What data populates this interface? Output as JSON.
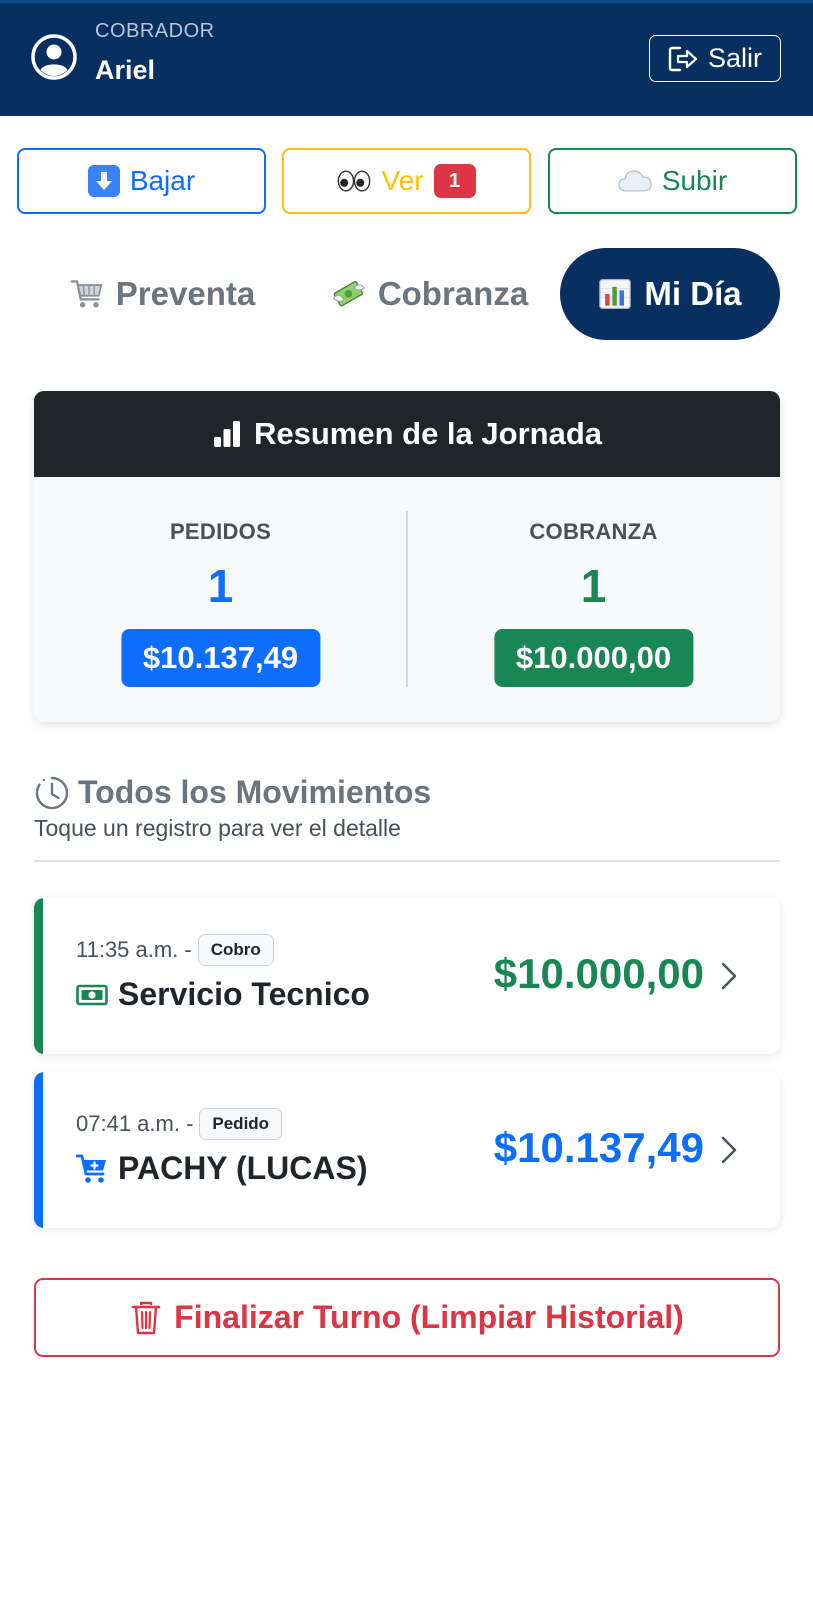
{
  "header": {
    "role_label": "COBRADOR",
    "user_name": "Ariel",
    "logout_label": "Salir",
    "background_color": "#072f5f"
  },
  "actions": {
    "download_label": "Bajar",
    "view_label": "Ver",
    "view_badge": "1",
    "upload_label": "Subir",
    "colors": {
      "download": "#0d6efd",
      "view": "#ffc107",
      "upload": "#198754"
    }
  },
  "tabs": [
    {
      "label": "Preventa",
      "icon": "cart-emoji",
      "active": false
    },
    {
      "label": "Cobranza",
      "icon": "money-wings-emoji",
      "active": false
    },
    {
      "label": "Mi Día",
      "icon": "bar-chart-emoji",
      "active": true
    }
  ],
  "summary": {
    "title": "Resumen de la Jornada",
    "pedidos": {
      "label": "PEDIDOS",
      "count": "1",
      "amount": "$10.137,49",
      "color": "#0d6efd"
    },
    "cobranza": {
      "label": "COBRANZA",
      "count": "1",
      "amount": "$10.000,00",
      "color": "#198754"
    }
  },
  "movements": {
    "title": "Todos los Movimientos",
    "subtitle": "Toque un registro para ver el detalle",
    "items": [
      {
        "time": "11:35 a.m. -",
        "tag": "Cobro",
        "name": "Servicio Tecnico",
        "amount": "$10.000,00",
        "icon": "cash-icon",
        "color": "#198754"
      },
      {
        "time": "07:41 a.m. -",
        "tag": "Pedido",
        "name": "PACHY (LUCAS)",
        "amount": "$10.137,49",
        "icon": "cart-icon",
        "color": "#0d6efd"
      }
    ]
  },
  "finalize": {
    "label": "Finalizar Turno (Limpiar Historial)",
    "color": "#dc3545"
  }
}
